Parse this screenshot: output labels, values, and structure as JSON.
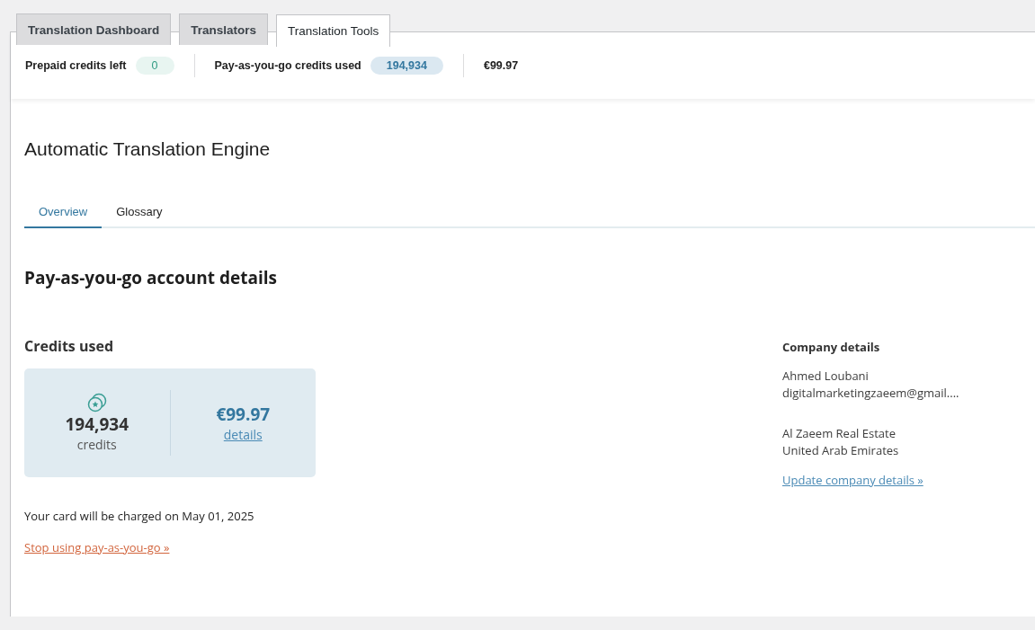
{
  "tabs": [
    {
      "label": "Translation Dashboard",
      "selected": false
    },
    {
      "label": "Translators",
      "selected": false
    },
    {
      "label": "Translation Tools",
      "selected": true
    }
  ],
  "stats": [
    {
      "kind": "badge-green",
      "label": "Prepaid credits left",
      "value": "0"
    },
    {
      "kind": "badge-blue",
      "label": "Pay-as-you-go credits used",
      "value": "194,934"
    },
    {
      "kind": "plain",
      "value": "€99.97"
    }
  ],
  "page_title": "Automatic Translation Engine",
  "subtabs": [
    {
      "label": "Overview",
      "selected": true
    },
    {
      "label": "Glossary",
      "selected": false
    }
  ],
  "section_title": "Pay-as-you-go account details",
  "credits": {
    "heading": "Credits used",
    "amount": "194,934",
    "unit": "credits",
    "cost": "€99.97",
    "details_link": "details",
    "charge_note": "Your card will be charged on May 01, 2025",
    "stop_link": "Stop using pay-as-you-go »"
  },
  "company": {
    "heading": "Company details",
    "contact": [
      "Ahmed Loubani",
      "digitalmarketingzaeem@gmail...."
    ],
    "address": [
      "Al Zaeem Real Estate",
      "United Arab Emirates"
    ],
    "update_link": "Update company details »"
  }
}
